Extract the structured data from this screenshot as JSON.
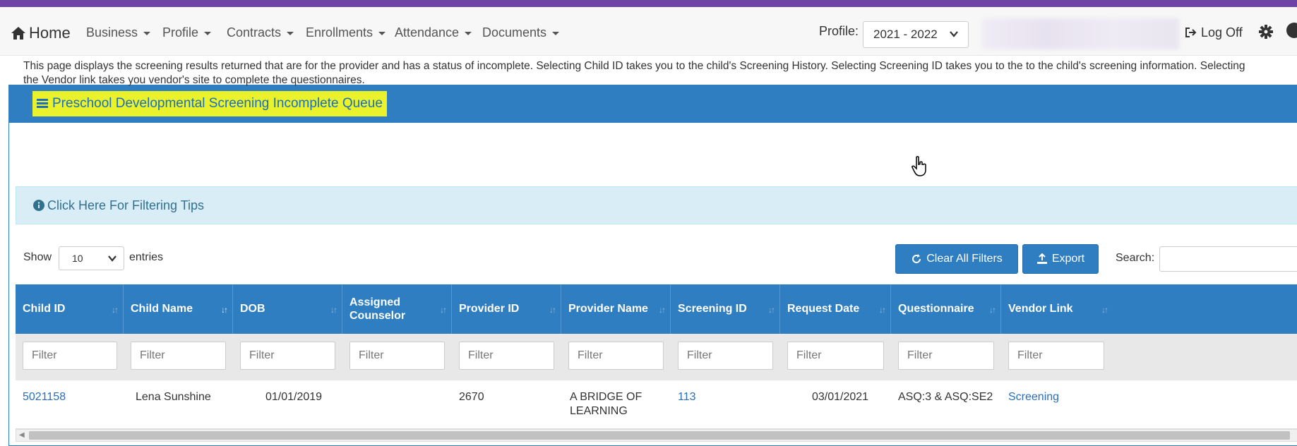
{
  "nav": {
    "home": "Home",
    "items": [
      "Business",
      "Profile",
      "Contracts",
      "Enrollments",
      "Attendance",
      "Documents"
    ],
    "profile_label": "Profile:",
    "profile_value": "2021 - 2022",
    "logoff": "Log Off"
  },
  "panel": {
    "title": "Preschool Developmental Screening Incomplete Queue",
    "description": "This page displays the screening results returned that are for the provider and has a status of incomplete. Selecting Child ID takes you to the child's Screening History. Selecting Screening ID takes you to the to the child's screening information. Selecting the Vendor link takes you vendor's site to complete the questionnaires.",
    "tips": "Click Here For Filtering Tips"
  },
  "controls": {
    "show": "Show",
    "entries_value": "10",
    "entries": "entries",
    "clear_filters": "Clear All Filters",
    "export": "Export",
    "search_label": "Search:"
  },
  "table": {
    "headers": [
      "Child ID",
      "Child Name",
      "DOB",
      "Assigned Counselor",
      "Provider ID",
      "Provider Name",
      "Screening ID",
      "Request Date",
      "Questionnaire",
      "Vendor Link"
    ],
    "filter_placeholder": "Filter",
    "rows": [
      [
        "5021158",
        "Lena Sunshine",
        "01/01/2019",
        "",
        "2670",
        "A BRIDGE OF LEARNING",
        "113",
        "03/01/2021",
        "ASQ:3 & ASQ:SE2",
        "Screening"
      ]
    ]
  },
  "colors": {
    "accent_purple": "#6f42a6",
    "primary_blue": "#2f7ec2",
    "highlight_yellow": "#e9f22a",
    "info_bg": "#d9edf7"
  }
}
